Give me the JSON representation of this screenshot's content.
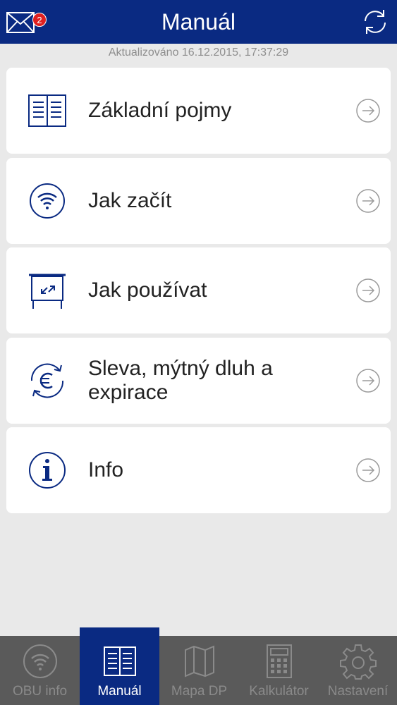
{
  "header": {
    "title": "Manuál",
    "mail_badge": "2",
    "mail_icon": "envelope-icon",
    "refresh_icon": "refresh-icon"
  },
  "updated_text": "Aktualizováno 16.12.2015, 17:37:29",
  "menu": [
    {
      "label": "Základní pojmy",
      "icon": "book-icon"
    },
    {
      "label": "Jak začít",
      "icon": "wifi-icon"
    },
    {
      "label": "Jak používat",
      "icon": "projector-icon"
    },
    {
      "label": "Sleva, mýtný dluh a expirace",
      "icon": "euro-cycle-icon"
    },
    {
      "label": "Info",
      "icon": "info-icon"
    }
  ],
  "bottom_nav": [
    {
      "label": "OBU info",
      "icon": "wifi-icon",
      "active": false
    },
    {
      "label": "Manuál",
      "icon": "book-icon",
      "active": true
    },
    {
      "label": "Mapa DP",
      "icon": "map-icon",
      "active": false
    },
    {
      "label": "Kalkulátor",
      "icon": "calculator-icon",
      "active": false
    },
    {
      "label": "Nastavení",
      "icon": "gear-icon",
      "active": false
    }
  ],
  "colors": {
    "brand": "#0a2a82",
    "background": "#e9e9e9",
    "nav_background": "#5a5a5a",
    "badge": "#e02020"
  }
}
